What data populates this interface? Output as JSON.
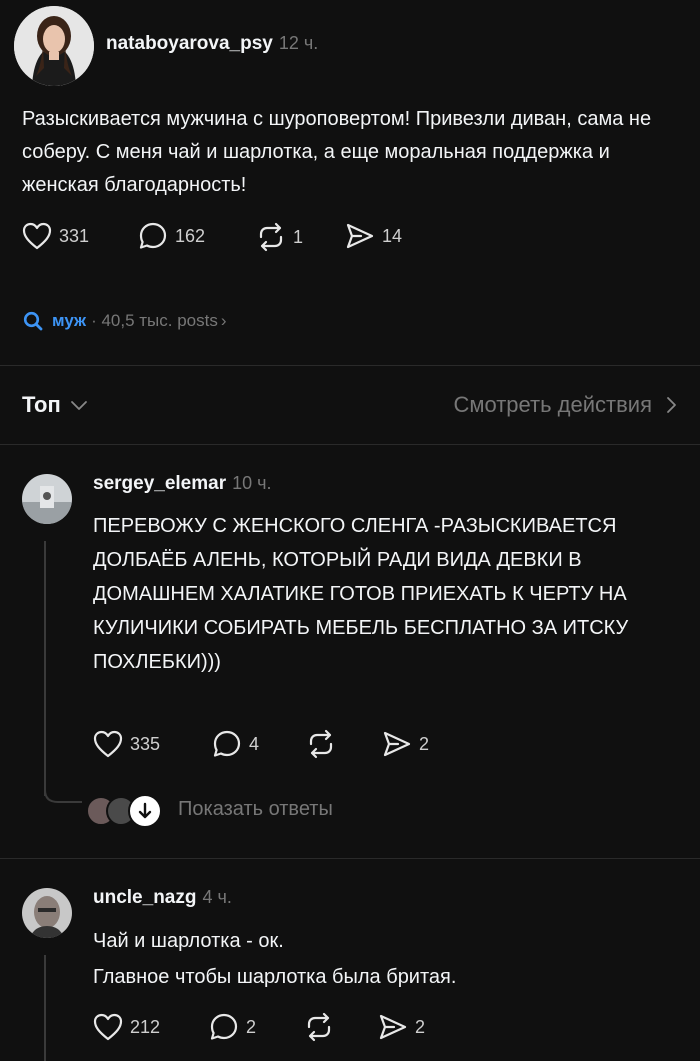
{
  "post": {
    "username": "natabo yarova_psy",
    "time": "12 ч.",
    "text": "Разыскивается мужчина с шуроповертом! Привезли диван, сама не соберу. С меня чай и шарлотка, а еще моральная поддержка и женская благодарность!",
    "likes": "331",
    "comments": "162",
    "reposts": "1",
    "shares": "14"
  },
  "topic": {
    "name": "муж",
    "count": "· 40,5 тыс. posts",
    "chevron": "›"
  },
  "sort": {
    "label": "Топ",
    "view_activity": "Смотреть действия"
  },
  "comments": [
    {
      "username": "sergey_elemar",
      "time": "10 ч.",
      "text": "ПЕРЕВОЖУ С ЖЕНСКОГО СЛЕНГА -РАЗЫСКИВАЕТСЯ ДОЛБАЁБ АЛЕНЬ, КОТОРЫЙ РАДИ ВИДА ДЕВКИ В ДОМАШНЕМ ХАЛАТИКЕ ГОТОВ ПРИЕХАТЬ К ЧЕРТУ НА КУЛИЧИКИ СОБИРАТЬ МЕБЕЛЬ БЕСПЛАТНО ЗА ИТСКУ ПОХЛЕБКИ)))",
      "likes": "335",
      "comments": "4",
      "shares": "2",
      "show_replies": "Показать ответы"
    },
    {
      "username": "uncle_nazg",
      "time": "4 ч.",
      "line1": "Чай и шарлотка - ок.",
      "line2": "Главное чтобы шарлотка была бритая.",
      "likes": "212",
      "comments": "2",
      "shares": "2"
    }
  ],
  "colors": {
    "background": "#101010",
    "text": "#f3f5f7",
    "muted": "#777777",
    "accent": "#3d94f5"
  },
  "icons": [
    "heart-icon",
    "comment-icon",
    "repost-icon",
    "share-icon",
    "search-icon",
    "chevron-down-icon",
    "chevron-right-icon",
    "arrow-down-icon"
  ]
}
